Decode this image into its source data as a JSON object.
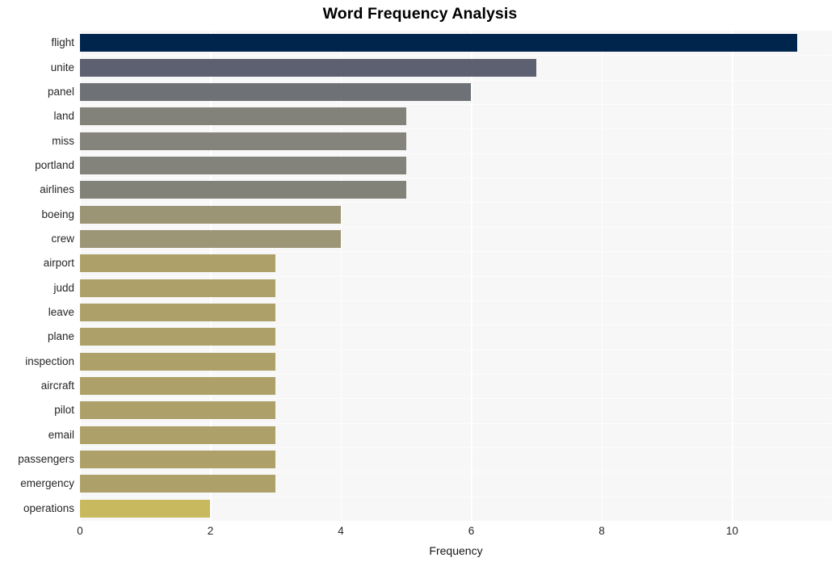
{
  "chart_data": {
    "type": "bar",
    "orientation": "horizontal",
    "title": "Word Frequency Analysis",
    "xlabel": "Frequency",
    "ylabel": "",
    "categories": [
      "flight",
      "unite",
      "panel",
      "land",
      "miss",
      "portland",
      "airlines",
      "boeing",
      "crew",
      "airport",
      "judd",
      "leave",
      "plane",
      "inspection",
      "aircraft",
      "pilot",
      "email",
      "passengers",
      "emergency",
      "operations"
    ],
    "values": [
      11,
      7,
      6,
      5,
      5,
      5,
      5,
      4,
      4,
      3,
      3,
      3,
      3,
      3,
      3,
      3,
      3,
      3,
      3,
      2
    ],
    "bar_colors": [
      "#00254d",
      "#5c6070",
      "#6e7175",
      "#83827a",
      "#85847c",
      "#84837b",
      "#838279",
      "#9b9475",
      "#9c9576",
      "#ad a169",
      "#ada169",
      "#ada169",
      "#ada169",
      "#ada169",
      "#ada169",
      "#ada169",
      "#ada169",
      "#ada169",
      "#ada169",
      "#c9b95e"
    ],
    "xlim": [
      0,
      11.53
    ],
    "ylim_count": 20,
    "xticks": [
      0,
      2,
      4,
      6,
      8,
      10
    ],
    "xticklabels": [
      "0",
      "2",
      "4",
      "6",
      "8",
      "10"
    ],
    "grid": "vertical-white-on-light-gray",
    "legend": null,
    "colormap": "cividis",
    "plot_background": "#f7f7f7",
    "figure_background": "#ffffff"
  }
}
